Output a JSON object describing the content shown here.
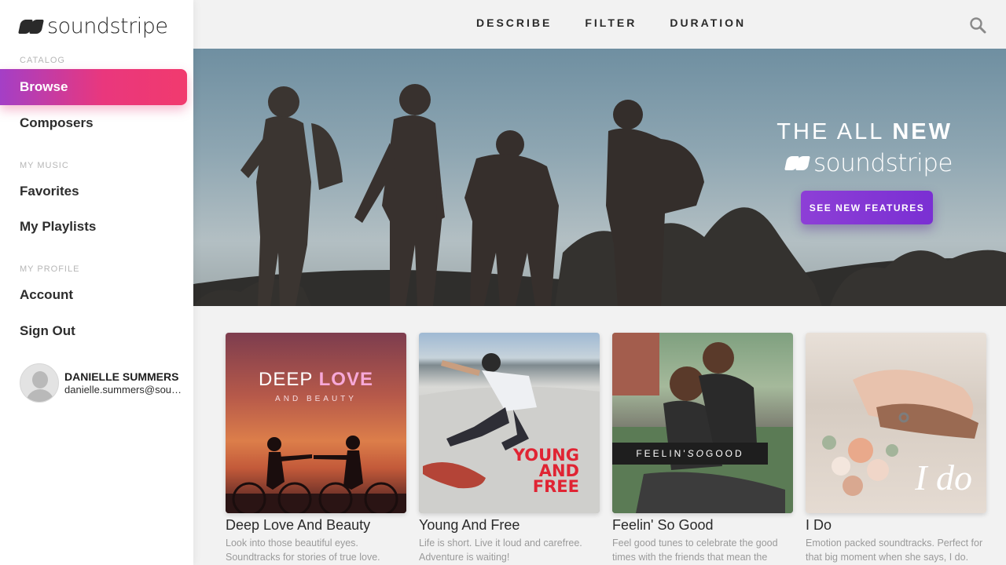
{
  "brand": {
    "name": "soundstripe"
  },
  "sidebar": {
    "sections": [
      {
        "label": "CATALOG",
        "items": [
          "Browse",
          "Composers"
        ]
      },
      {
        "label": "MY MUSIC",
        "items": [
          "Favorites",
          "My Playlists"
        ]
      },
      {
        "label": "MY PROFILE",
        "items": [
          "Account",
          "Sign Out"
        ]
      }
    ],
    "active_item": "Browse",
    "user": {
      "name": "DANIELLE SUMMERS",
      "email": "danielle.summers@soundstripe.com"
    }
  },
  "topnav": {
    "links": [
      "DESCRIBE",
      "FILTER",
      "DURATION"
    ],
    "search_icon": "search-icon"
  },
  "hero": {
    "title_light": "THE ALL ",
    "title_bold": "NEW",
    "logo_text": "soundstripe",
    "cta": "SEE NEW FEATURES"
  },
  "playlists": [
    {
      "title": "Deep Love And Beauty",
      "description": "Look into those beautiful eyes. Soundtracks for stories of true love.",
      "art_text_light": "DEEP ",
      "art_text_bold": "LOVE",
      "art_subtext": "AND BEAUTY"
    },
    {
      "title": "Young And Free",
      "description": "Life is short. Live it loud and carefree. Adventure is waiting!",
      "art_lines": [
        "YOUNG",
        "AND",
        "FREE"
      ]
    },
    {
      "title": "Feelin' So Good",
      "description": "Feel good tunes to celebrate the good times with the friends that mean the",
      "art_text_pre": "FEELIN' ",
      "art_text_em": "SO",
      "art_text_post": " GOOD"
    },
    {
      "title": "I Do",
      "description": "Emotion packed soundtracks. Perfect for that big moment when she says, I do.",
      "art_text": "I do"
    }
  ],
  "colors": {
    "active_gradient_start": "#a43fc6",
    "active_gradient_end": "#f13a6e",
    "cta_purple": "#8d3fd6",
    "young_red": "#e02433",
    "love_pink": "#f7a8d8"
  }
}
